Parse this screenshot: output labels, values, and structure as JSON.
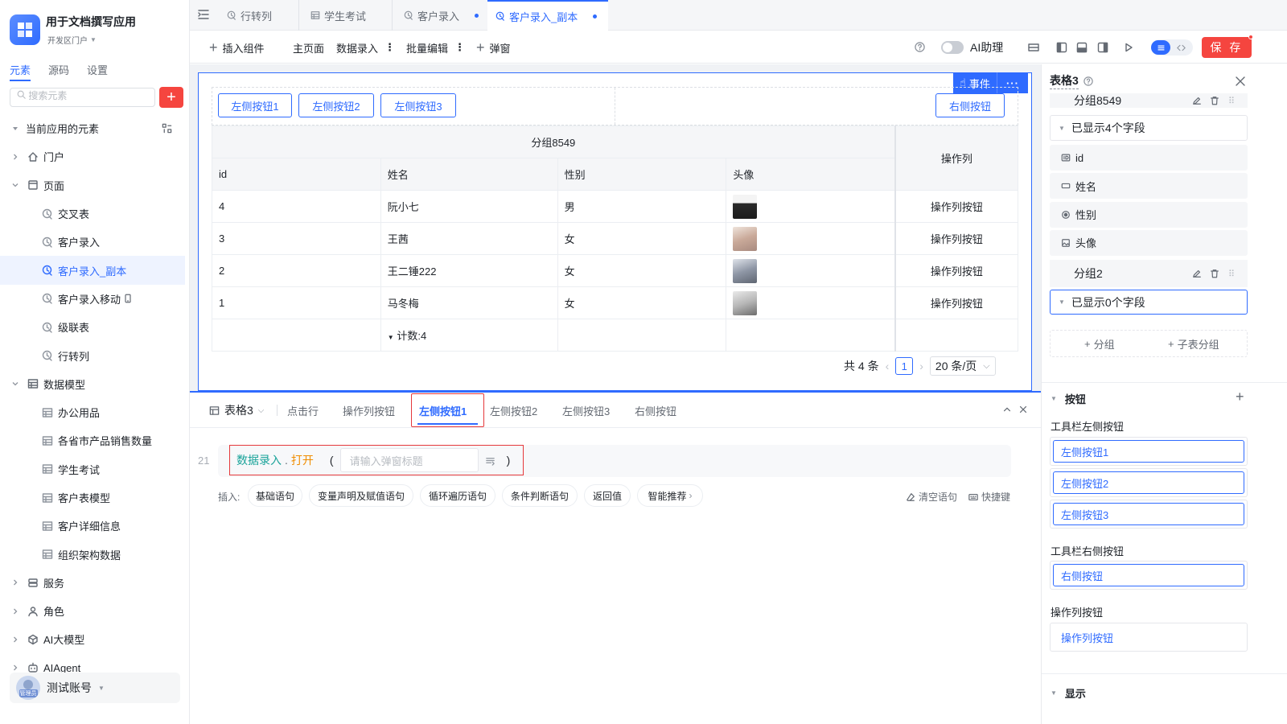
{
  "app": {
    "name": "用于文档撰写应用",
    "portal": "开发区门户"
  },
  "left_tabs": [
    "元素",
    "源码",
    "设置"
  ],
  "search": {
    "placeholder": "搜索元素"
  },
  "tree_header": "当前应用的元素",
  "tree": [
    {
      "label": "门户",
      "icon": "home-icon",
      "level": 0,
      "caret": "right"
    },
    {
      "label": "页面",
      "icon": "page-icon",
      "level": 0,
      "caret": "down"
    },
    {
      "label": "交叉表",
      "icon": "page-link-icon",
      "level": 1
    },
    {
      "label": "客户录入",
      "icon": "page-link-icon",
      "level": 1
    },
    {
      "label": "客户录入_副本",
      "icon": "page-link-icon",
      "level": 1,
      "selected": true
    },
    {
      "label": "客户录入移动",
      "icon": "page-link-icon",
      "level": 1,
      "mobile": true
    },
    {
      "label": "级联表",
      "icon": "page-link-icon",
      "level": 1
    },
    {
      "label": "行转列",
      "icon": "page-link-icon",
      "level": 1
    },
    {
      "label": "数据模型",
      "icon": "table-icon",
      "level": 0,
      "caret": "down"
    },
    {
      "label": "办公用品",
      "icon": "table-icon",
      "level": 1
    },
    {
      "label": "各省市产品销售数量",
      "icon": "table-icon",
      "level": 1
    },
    {
      "label": "学生考试",
      "icon": "table-icon",
      "level": 1
    },
    {
      "label": "客户表模型",
      "icon": "table-icon",
      "level": 1
    },
    {
      "label": "客户详细信息",
      "icon": "table-icon",
      "level": 1
    },
    {
      "label": "组织架构数据",
      "icon": "table-icon",
      "level": 1
    },
    {
      "label": "服务",
      "icon": "service-icon",
      "level": 0,
      "caret": "right"
    },
    {
      "label": "角色",
      "icon": "role-icon",
      "level": 0,
      "caret": "right"
    },
    {
      "label": "AI大模型",
      "icon": "model-icon",
      "level": 0,
      "caret": "right"
    },
    {
      "label": "AIAgent",
      "icon": "robot-icon",
      "level": 0,
      "caret": "right"
    }
  ],
  "account": {
    "name": "测试账号",
    "role": "管理员"
  },
  "page_tabs": [
    {
      "label": "行转列",
      "icon": "page-link-icon"
    },
    {
      "label": "学生考试",
      "icon": "table-icon"
    },
    {
      "label": "客户录入",
      "icon": "page-link-icon",
      "dot": true
    },
    {
      "label": "客户录入_副本",
      "icon": "page-link-icon",
      "dot": true,
      "active": true
    }
  ],
  "toolbar": {
    "insert": "插入组件",
    "main_page": "主页面",
    "data_entry": "数据录入",
    "batch_edit": "批量编辑",
    "popup": "弹窗",
    "ai_assistant": "AI助理",
    "save": "保 存"
  },
  "canvas": {
    "event_label": "事件",
    "more": "···",
    "left_buttons": [
      "左侧按钮1",
      "左侧按钮2",
      "左侧按钮3"
    ],
    "right_button": "右侧按钮",
    "group_header": "分组8549",
    "op_header": "操作列",
    "columns": [
      "id",
      "姓名",
      "性别",
      "头像"
    ],
    "rows": [
      {
        "id": "4",
        "name": "阮小七",
        "gender": "男",
        "op": "操作列按钮"
      },
      {
        "id": "3",
        "name": "王茜",
        "gender": "女",
        "op": "操作列按钮"
      },
      {
        "id": "2",
        "name": "王二锤222",
        "gender": "女",
        "op": "操作列按钮"
      },
      {
        "id": "1",
        "name": "马冬梅",
        "gender": "女",
        "op": "操作列按钮"
      }
    ],
    "summary": "计数:4",
    "pager": {
      "total": "共 4 条",
      "page": "1",
      "size": "20 条/页"
    }
  },
  "bottom": {
    "tabs": [
      "表格3",
      "点击行",
      "操作列按钮",
      "左侧按钮1",
      "左侧按钮2",
      "左侧按钮3",
      "右侧按钮"
    ],
    "active_tab": "左侧按钮1",
    "line_no": "21",
    "code_obj": "数据录入",
    "code_dot": ".",
    "code_method": "打开",
    "paren_open": "(",
    "paren_close": ")",
    "title_placeholder": "请输入弹窗标题",
    "insert_label": "插入:",
    "chips": [
      "基础语句",
      "变量声明及赋值语句",
      "循环遍历语句",
      "条件判断语句",
      "返回值",
      "智能推荐"
    ],
    "clear": "清空语句",
    "shortcut": "快捷键"
  },
  "right": {
    "title": "表格3",
    "group1": "分组8549",
    "group1_shown": "已显示4个字段",
    "fields": [
      {
        "label": "id",
        "icon": "id-field-icon"
      },
      {
        "label": "姓名",
        "icon": "text-field-icon"
      },
      {
        "label": "性别",
        "icon": "radio-field-icon"
      },
      {
        "label": "头像",
        "icon": "image-field-icon"
      }
    ],
    "group2": "分组2",
    "group2_shown": "已显示0个字段",
    "add_group": "分组",
    "add_sub_group": "子表分组",
    "buttons_section": "按钮",
    "toolbar_left_label": "工具栏左侧按钮",
    "toolbar_left": [
      "左侧按钮1",
      "左侧按钮2",
      "左侧按钮3"
    ],
    "toolbar_right_label": "工具栏右侧按钮",
    "toolbar_right": [
      "右侧按钮"
    ],
    "op_col_label": "操作列按钮",
    "op_col": [
      "操作列按钮"
    ],
    "display_section": "显示"
  },
  "colors": {
    "primary": "#2f6bff",
    "danger": "#f5453f",
    "highlight_box": "#e5383b",
    "code_object": "#1aa39a",
    "code_method": "#f08c00"
  }
}
